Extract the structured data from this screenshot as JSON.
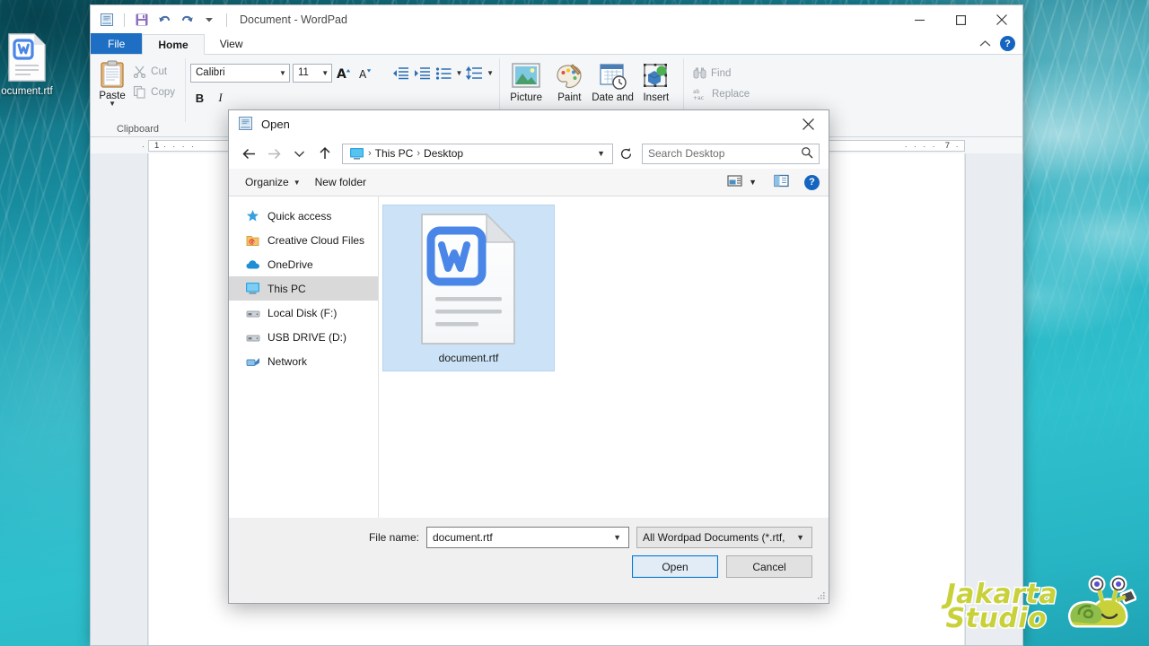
{
  "desktop": {
    "icon": {
      "name": "ocument.rtf",
      "icon": "wordpad-document-icon"
    }
  },
  "wordpad": {
    "title": "Document - WordPad",
    "quick_access": [
      {
        "name": "wordpad-app-icon",
        "label": "WordPad"
      },
      {
        "name": "save-icon",
        "label": "Save"
      },
      {
        "name": "undo-icon",
        "label": "Undo"
      },
      {
        "name": "redo-icon",
        "label": "Redo"
      },
      {
        "name": "customize-qat-icon",
        "label": "Customize Quick Access Toolbar"
      }
    ],
    "window_buttons": [
      {
        "name": "minimize-button",
        "label": "Minimize"
      },
      {
        "name": "maximize-button",
        "label": "Maximize"
      },
      {
        "name": "close-button",
        "label": "Close"
      }
    ],
    "tabs": [
      {
        "label": "File",
        "state": "menu"
      },
      {
        "label": "Home",
        "state": "active"
      },
      {
        "label": "View",
        "state": "normal"
      }
    ],
    "ribbon_collapse": "Minimize the Ribbon",
    "help": "?",
    "clipboard": {
      "paste": "Paste",
      "cut": "Cut",
      "copy": "Copy",
      "group_label": "Clipboard"
    },
    "font": {
      "family": "Calibri",
      "size": "11",
      "grow": "Grow font",
      "shrink": "Shrink font",
      "bold": "B",
      "italic": "I"
    },
    "paragraph": {
      "decrease_indent": "Decrease indent",
      "increase_indent": "Increase indent",
      "bullets": "Start a list",
      "line_spacing": "Line spacing"
    },
    "insert": [
      {
        "label": "Picture",
        "icon": "picture-icon"
      },
      {
        "label": "Paint",
        "icon": "paint-drawing-icon"
      },
      {
        "label": "Date and",
        "icon": "date-time-icon"
      },
      {
        "label": "Insert",
        "icon": "insert-object-icon"
      }
    ],
    "editing": {
      "find": "Find",
      "replace": "Replace"
    },
    "ruler": {
      "left_number": "1",
      "right_number": "7"
    }
  },
  "open_dialog": {
    "title": "Open",
    "title_icon": "wordpad-app-icon",
    "close": "Close",
    "nav": {
      "back": "Back",
      "forward": "Forward",
      "recent": "Recent locations",
      "up": "Up one level",
      "refresh": "Refresh"
    },
    "breadcrumb": {
      "icon": "this-pc-icon",
      "items": [
        "This PC",
        "Desktop"
      ],
      "separator": "›"
    },
    "search": {
      "placeholder": "Search Desktop",
      "value": ""
    },
    "toolbar": {
      "organize": "Organize",
      "new_folder": "New folder",
      "view_options": "Change your view",
      "preview_pane": "Show the preview pane",
      "help": "?"
    },
    "sidebar": [
      {
        "label": "Quick access",
        "icon": "star-icon",
        "selected": false
      },
      {
        "label": "Creative Cloud Files",
        "icon": "creative-cloud-icon",
        "selected": false
      },
      {
        "label": "OneDrive",
        "icon": "cloud-icon",
        "selected": false
      },
      {
        "label": "This PC",
        "icon": "this-pc-icon",
        "selected": true
      },
      {
        "label": "Local Disk (F:)",
        "icon": "drive-icon",
        "selected": false
      },
      {
        "label": "USB DRIVE (D:)",
        "icon": "drive-icon",
        "selected": false
      },
      {
        "label": "Network",
        "icon": "network-icon",
        "selected": false
      }
    ],
    "files": [
      {
        "label": "document.rtf",
        "icon": "wordpad-document-icon",
        "selected": true
      }
    ],
    "footer": {
      "file_name_label": "File name:",
      "file_name_value": "document.rtf",
      "filter_value": "All Wordpad Documents (*.rtf,",
      "open_button": "Open",
      "cancel_button": "Cancel"
    }
  },
  "watermark": {
    "line1": "Jakarta",
    "line2": "Studio",
    "mascot": "snail-mascot-icon"
  },
  "colors": {
    "accent_blue": "#0078d7",
    "file_tab_blue": "#1e6fc4",
    "selection_blue": "#cce3f7",
    "desktop_teal": "#2ab6c6",
    "watermark_yellow": "#c9d13a"
  }
}
